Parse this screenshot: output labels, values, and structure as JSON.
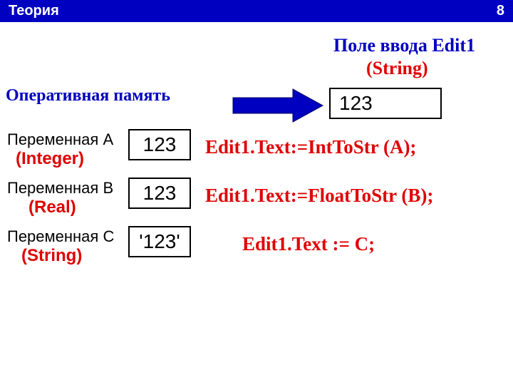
{
  "header": {
    "title": "Теория",
    "page": "8"
  },
  "left": {
    "heading": "Оперативная память",
    "varA": {
      "name": "Переменная A",
      "type": "(Integer)",
      "value": "123"
    },
    "varB": {
      "name": "Переменная B",
      "type": "(Real)",
      "value": "123"
    },
    "varC": {
      "name": "Переменная C",
      "type": "(String)",
      "value": "'123'"
    }
  },
  "right": {
    "fieldTitle": "Поле ввода Edit1",
    "fieldType": "(String)",
    "fieldValue": "123",
    "codeA": "Edit1.Text:=IntToStr (A);",
    "codeB": "Edit1.Text:=FloatToStr (B);",
    "codeC": "Edit1.Text := C;"
  }
}
